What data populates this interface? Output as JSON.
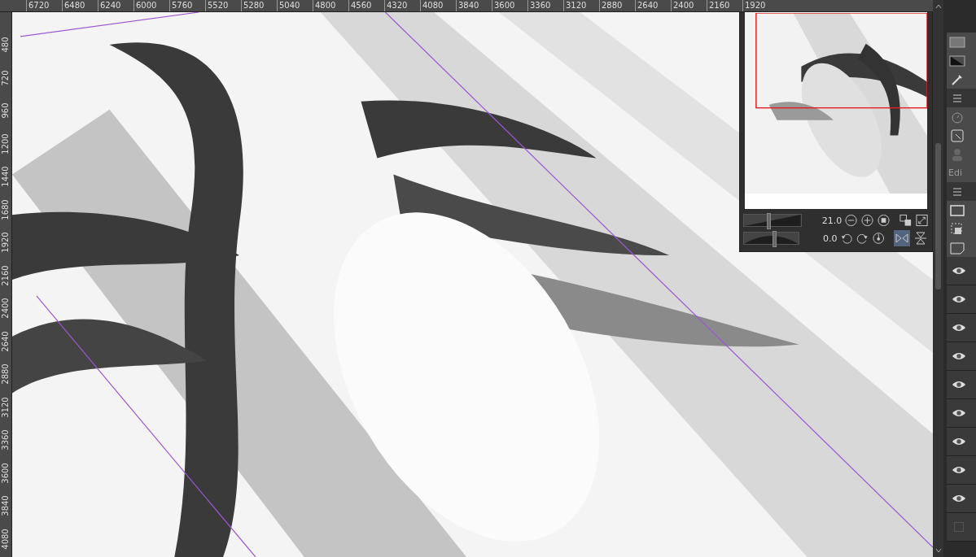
{
  "ruler": {
    "top_labels": [
      "6720",
      "6480",
      "6240",
      "6000",
      "5760",
      "5520",
      "5280",
      "5040",
      "4800",
      "4560",
      "4320",
      "4080",
      "3840",
      "3600",
      "3360",
      "3120",
      "2880",
      "2640",
      "2400",
      "2160",
      "1920"
    ],
    "left_labels": [
      "480",
      "720",
      "960",
      "1200",
      "1440",
      "1680",
      "1920",
      "2160",
      "2400",
      "2640",
      "2880",
      "3120",
      "3360",
      "3600",
      "3840",
      "4080"
    ]
  },
  "navigator": {
    "zoom": "21.0",
    "zoom_slider": {
      "level": 0.4
    },
    "rotation": "0.0",
    "rotation_slider": {
      "level": 0.52
    },
    "flip_horizontal": true,
    "flip_vertical": false
  },
  "side_panel": {
    "edit_label": "Edi"
  },
  "layers": [
    {
      "visible": true
    },
    {
      "visible": true
    },
    {
      "visible": true
    },
    {
      "visible": true
    },
    {
      "visible": true
    },
    {
      "visible": true
    },
    {
      "visible": true
    },
    {
      "visible": true
    },
    {
      "visible": true
    },
    {
      "visible": false
    }
  ]
}
